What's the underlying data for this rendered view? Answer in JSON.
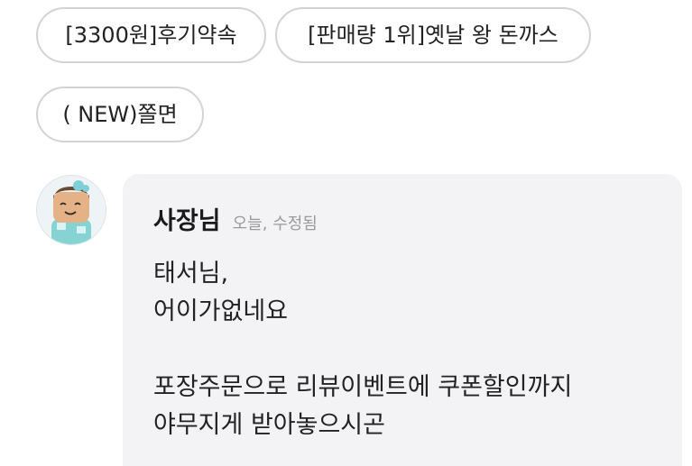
{
  "menu_chips": [
    {
      "label": "[3300원]후기약속"
    },
    {
      "label": "[판매량 1위]옛날 왕 돈까스"
    },
    {
      "label": "( NEW)쫄면"
    }
  ],
  "comment": {
    "avatar_icon": "owner-avatar-icon",
    "author": "사장님",
    "meta": "오늘, 수정됨",
    "lines": [
      "태서님,",
      "어이가없네요",
      "",
      "포장주문으로 리뷰이벤트에 쿠폰할인까지",
      "야무지게 받아놓으시곤"
    ]
  },
  "colors": {
    "chip_border": "#d3d3d3",
    "card_background": "#f3f3f5",
    "meta_text": "#9a9a9a"
  }
}
